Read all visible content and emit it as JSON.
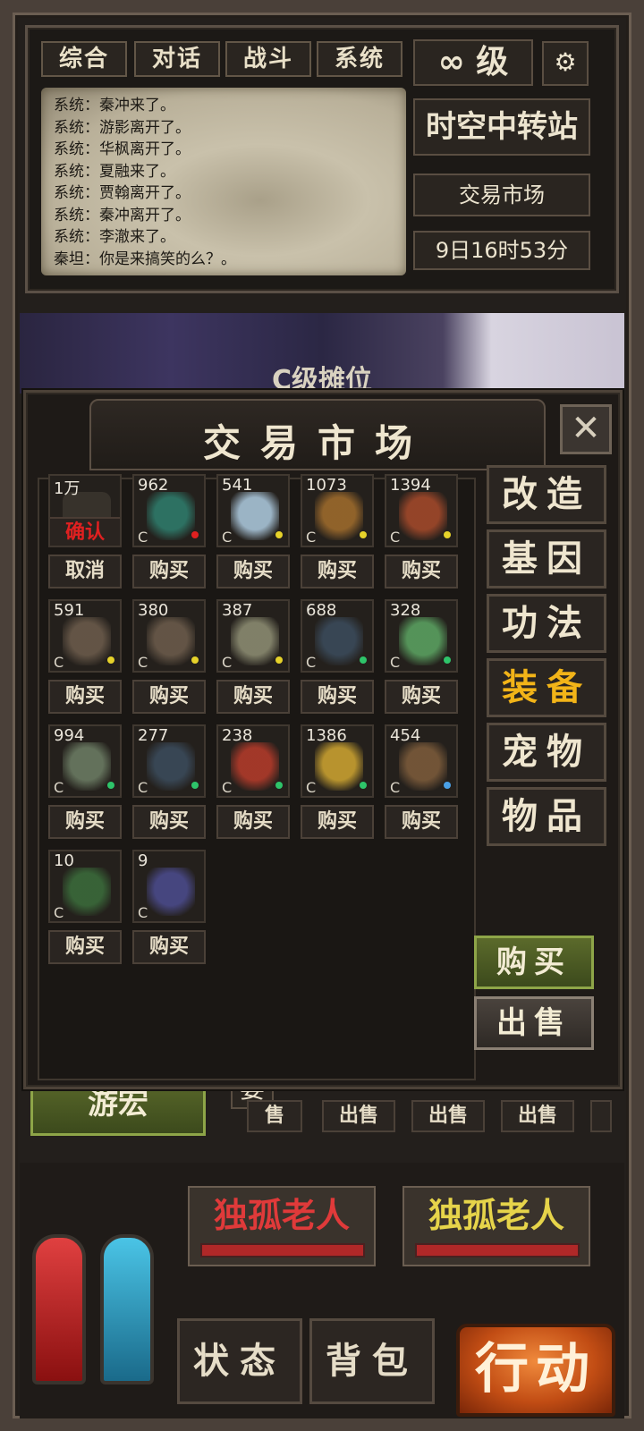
{
  "chat": {
    "tabs": [
      "综合",
      "对话",
      "战斗",
      "系统"
    ],
    "lines": [
      "系统：秦冲来了。",
      "系统：游影离开了。",
      "系统：华枫离开了。",
      "系统：夏融来了。",
      "系统：贾翰离开了。",
      "系统：秦冲离开了。",
      "系统：李澈来了。",
      "秦坦：你是来搞笑的么？。"
    ]
  },
  "status": {
    "level": "∞ 级",
    "location": "时空中转站",
    "place": "交易市场",
    "time": "9日16时53分"
  },
  "scene": {
    "stall_title": "C级摊位"
  },
  "market": {
    "title": "交易市场",
    "confirm_label": "确认",
    "cancel_label": "取消",
    "buy_label": "购买",
    "pending_price": "1万",
    "items": [
      {
        "price": "962",
        "grade": "C",
        "dot": "#e02020",
        "art": "#2e7a6a"
      },
      {
        "price": "541",
        "grade": "C",
        "dot": "#e6d22a",
        "art": "#a8c4d8"
      },
      {
        "price": "1073",
        "grade": "C",
        "dot": "#e6d22a",
        "art": "#9c6a2c"
      },
      {
        "price": "1394",
        "grade": "C",
        "dot": "#e6d22a",
        "art": "#a0482a"
      },
      {
        "price": "591",
        "grade": "C",
        "dot": "#e6d22a",
        "art": "#6a5a4a"
      },
      {
        "price": "380",
        "grade": "C",
        "dot": "#e6d22a",
        "art": "#6a5a4a"
      },
      {
        "price": "387",
        "grade": "C",
        "dot": "#e6d22a",
        "art": "#8a8a70"
      },
      {
        "price": "688",
        "grade": "C",
        "dot": "#2ec46a",
        "art": "#3a4a5a"
      },
      {
        "price": "328",
        "grade": "C",
        "dot": "#2ec46a",
        "art": "#5aa060"
      },
      {
        "price": "994",
        "grade": "C",
        "dot": "#2ec46a",
        "art": "#6a7a62"
      },
      {
        "price": "277",
        "grade": "C",
        "dot": "#2ec46a",
        "art": "#3a4a5a"
      },
      {
        "price": "238",
        "grade": "C",
        "dot": "#2ec46a",
        "art": "#b03a2a"
      },
      {
        "price": "1386",
        "grade": "C",
        "dot": "#2ec46a",
        "art": "#c8a030"
      },
      {
        "price": "454",
        "grade": "C",
        "dot": "#4aa0e6",
        "art": "#7a5a3a"
      },
      {
        "price": "10",
        "grade": "C",
        "dot": "",
        "art": "#3a6a3a"
      },
      {
        "price": "9",
        "grade": "C",
        "dot": "",
        "art": "#4a4a8a"
      }
    ],
    "categories": [
      "改造",
      "基因",
      "功法",
      "装备",
      "宠物",
      "物品"
    ],
    "active_category": "装备",
    "buy_button": "购买",
    "sell_button": "出售"
  },
  "background": {
    "player_button": "游宏",
    "tag": "要",
    "sell_label": "出售",
    "partial_sell": "售"
  },
  "bottom": {
    "npc_left": "独孤老人",
    "npc_right": "独孤老人",
    "status_button": "状态",
    "bag_button": "背包",
    "action_button": "行动"
  },
  "colors": {
    "active_category": "#f2b418",
    "npc_left_text": "#e03a3a",
    "npc_right_text": "#e6d44a",
    "confirm_text": "#e02020"
  }
}
